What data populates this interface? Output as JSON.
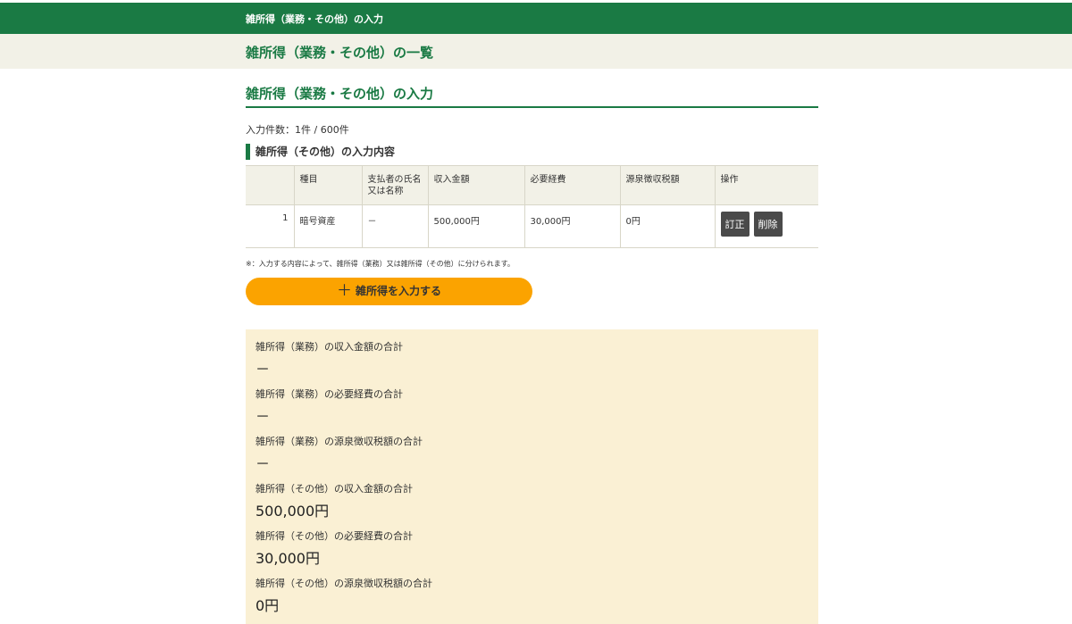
{
  "header": {
    "title": "雑所得（業務・その他）の入力",
    "breadcrumb": "雑所得（業務・その他）の一覧"
  },
  "main": {
    "section_title": "雑所得（業務・その他）の入力",
    "count_text": "入力件数：1件 / 600件",
    "table_heading": "雑所得（その他）の入力内容",
    "columns": [
      "",
      "種目",
      "支払者の氏名\n又は名称",
      "収入金額",
      "必要経費",
      "源泉徴収税額",
      "操作"
    ],
    "rows": [
      {
        "no": "1",
        "type": "暗号資産",
        "payer": "－",
        "income": "500,000円",
        "expense": "30,000円",
        "withholding": "0円",
        "edit_label": "訂正",
        "delete_label": "削除"
      }
    ],
    "note": "※：入力する内容によって、雑所得（業務）又は雑所得（その他）に分けられます。",
    "add_button": {
      "icon": "plus-icon",
      "label": "雑所得を入力する"
    }
  },
  "summary": [
    {
      "label": "雑所得（業務）の収入金額の合計",
      "value": "－"
    },
    {
      "label": "雑所得（業務）の必要経費の合計",
      "value": "－"
    },
    {
      "label": "雑所得（業務）の源泉徴収税額の合計",
      "value": "－"
    },
    {
      "label": "雑所得（その他）の収入金額の合計",
      "value": "500,000円"
    },
    {
      "label": "雑所得（その他）の必要経費の合計",
      "value": "30,000円"
    },
    {
      "label": "雑所得（その他）の源泉徴収税額の合計",
      "value": "0円"
    }
  ],
  "colors": {
    "brand_green": "#1a7a44",
    "header_bg": "#f2f1e7",
    "accent_orange": "#fba300",
    "summary_bg": "#faf0d4",
    "button_dark": "#4a4a4a"
  }
}
